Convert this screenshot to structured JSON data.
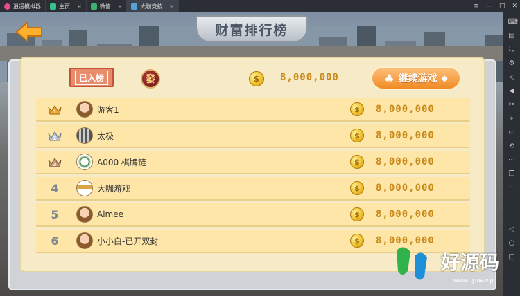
{
  "titlebar": {
    "tabs": [
      {
        "label": "逍遥模拟器",
        "color": "#e84d8a"
      },
      {
        "label": "主页",
        "color": "#35c28b"
      },
      {
        "label": "微信",
        "color": "#3cb371"
      },
      {
        "label": "大咖竞技",
        "color": "#5aa0d8"
      }
    ]
  },
  "game": {
    "title": "财富排行榜",
    "header": {
      "badge": "已入榜",
      "chip": "發",
      "coin_symbol": "$",
      "amount": "8,000,000",
      "continue_label": "继续游戏"
    },
    "rows": [
      {
        "rank": "1",
        "medal": "gold",
        "name": "游客1",
        "amount": "8,000,000",
        "avatar": "face"
      },
      {
        "rank": "2",
        "medal": "silver",
        "name": "太极",
        "amount": "8,000,000",
        "avatar": "grid"
      },
      {
        "rank": "3",
        "medal": "bronze",
        "name": "A000 棋牌链",
        "amount": "8,000,000",
        "avatar": "logo"
      },
      {
        "rank": "4",
        "medal": "",
        "name": "大咖游戏",
        "amount": "8,000,000",
        "avatar": "car"
      },
      {
        "rank": "5",
        "medal": "",
        "name": "Aimee",
        "amount": "8,000,000",
        "avatar": "face"
      },
      {
        "rank": "6",
        "medal": "",
        "name": "小小白-已开双封",
        "amount": "8,000,000",
        "avatar": "face"
      }
    ]
  },
  "watermark": {
    "text": "好源码",
    "url": "www.hyma.vip"
  },
  "colors": {
    "accent": "#f08b25",
    "gold_text": "#c98a1a",
    "row_bg": "#fde6a8"
  }
}
